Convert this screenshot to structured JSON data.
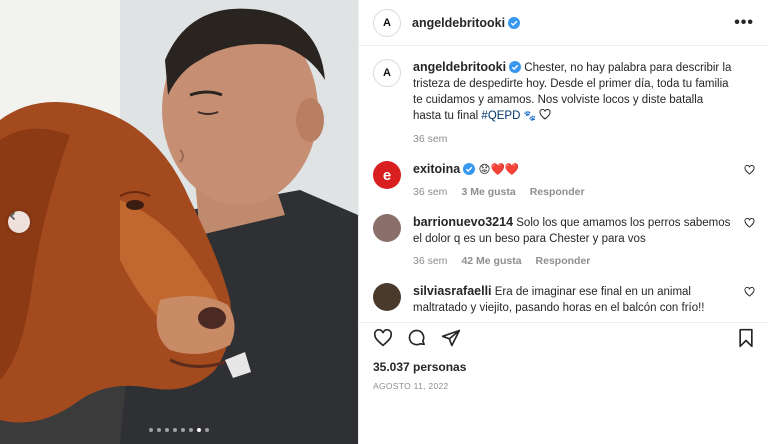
{
  "post": {
    "author": "angeldebritooki",
    "author_avatar_letter": "A",
    "verified": true,
    "more_icon": "more-horizontal-icon",
    "carousel": {
      "total": 8,
      "active": 7
    }
  },
  "caption": {
    "username": "angeldebritooki",
    "text": "Chester, no hay palabra para describir la tristeza de despedirte hoy. Desde el primer día, toda tu familia te cuidamos y amamos. Nos volviste locos y diste batalla hasta tu final",
    "hashtag": "#QEPD",
    "time": "36 sem"
  },
  "comments": [
    {
      "username": "exitoina",
      "verified": true,
      "text": "😟❤️❤️",
      "time": "36 sem",
      "likes": "3 Me gusta",
      "reply": "Responder",
      "avatar_color": "#d81e1e"
    },
    {
      "username": "barrionuevo3214",
      "verified": false,
      "text": "Solo los que amamos los perros sabemos el dolor q es un beso para Chester y para vos",
      "time": "36 sem",
      "likes": "42 Me gusta",
      "reply": "Responder",
      "avatar_color": "#8a6f6a"
    },
    {
      "username": "silviasrafaelli",
      "verified": false,
      "text": "Era de imaginar ese final en un animal maltratado y viejito, pasando horas en el balcón con frío!! Ladrando ( y",
      "time": "",
      "likes": "",
      "reply": "",
      "avatar_color": "#4a3a2c"
    }
  ],
  "likes_count": "35.037 personas",
  "date": "AGOSTO 11, 2022",
  "colors": {
    "link": "#00376b",
    "verified": "#3897f0",
    "secondary": "#8e8e8e",
    "heart_red": "#ed4956"
  }
}
